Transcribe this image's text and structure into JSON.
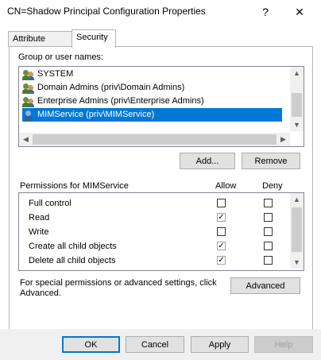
{
  "window": {
    "title": "CN=Shadow Principal Configuration Properties",
    "help_glyph": "?",
    "close_glyph": "✕"
  },
  "tabs": [
    {
      "label": "Attribute Editor"
    },
    {
      "label": "Security"
    }
  ],
  "security": {
    "group_label": "Group or user names:",
    "users": [
      {
        "name": "SYSTEM",
        "icon": "group-users-icon"
      },
      {
        "name": "Domain Admins (priv\\Domain Admins)",
        "icon": "group-users-icon"
      },
      {
        "name": "Enterprise Admins (priv\\Enterprise Admins)",
        "icon": "group-users-icon"
      },
      {
        "name": "MIMService (priv\\MIMService)",
        "icon": "user-icon",
        "selected": true
      }
    ],
    "add_label": "Add...",
    "remove_label": "Remove",
    "perm_header": "Permissions for MIMService",
    "allow_header": "Allow",
    "deny_header": "Deny",
    "permissions": [
      {
        "name": "Full control",
        "allow": false,
        "deny": false
      },
      {
        "name": "Read",
        "allow": true,
        "deny": false
      },
      {
        "name": "Write",
        "allow": false,
        "deny": false
      },
      {
        "name": "Create all child objects",
        "allow": true,
        "deny": false
      },
      {
        "name": "Delete all child objects",
        "allow": true,
        "deny": false
      }
    ],
    "special_text_1": "For special permissions or advanced settings, click",
    "special_text_2": "Advanced.",
    "advanced_label": "Advanced"
  },
  "footer": {
    "ok_label": "OK",
    "cancel_label": "Cancel",
    "apply_label": "Apply",
    "help_label": "Help"
  },
  "glyphs": {
    "up": "▲",
    "down": "▼",
    "left": "◀",
    "right": "▶",
    "check": "✓"
  }
}
